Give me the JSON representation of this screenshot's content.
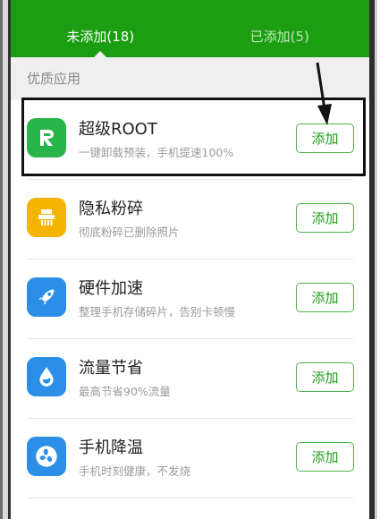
{
  "tabs": [
    {
      "label": "未添加(18)",
      "active": true
    },
    {
      "label": "已添加(5)",
      "active": false
    }
  ],
  "section": {
    "title": "优质应用"
  },
  "apps": [
    {
      "name": "超级ROOT",
      "desc": "一键卸载预装，手机提速100%",
      "icon": "root-icon",
      "color": "#2ab54a",
      "button": "添加"
    },
    {
      "name": "隐私粉碎",
      "desc": "彻底粉碎已删除照片",
      "icon": "shredder-icon",
      "color": "#f5b400",
      "button": "添加"
    },
    {
      "name": "硬件加速",
      "desc": "整理手机存储碎片，告别卡顿慢",
      "icon": "rocket-icon",
      "color": "#2b8fe8",
      "button": "添加"
    },
    {
      "name": "流量节省",
      "desc": "最高节省90%流量",
      "icon": "water-drop-icon",
      "color": "#2b8fe8",
      "button": "添加"
    },
    {
      "name": "手机降温",
      "desc": "手机时刻健康，不发烧",
      "icon": "fan-icon",
      "color": "#2b8fe8",
      "button": "添加"
    }
  ],
  "colors": {
    "accent": "#1c9e12",
    "button_text": "#1e9e16",
    "annotation": "#111111"
  }
}
